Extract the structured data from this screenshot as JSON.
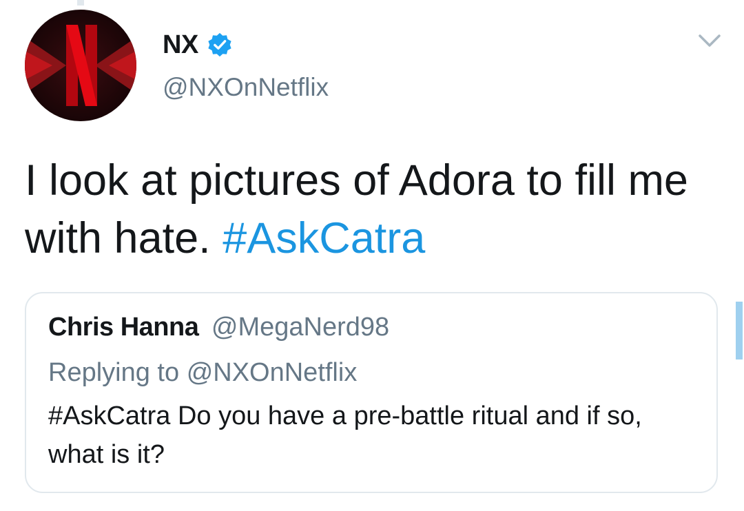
{
  "tweet": {
    "author": {
      "display_name": "NX",
      "handle": "@NXOnNetflix",
      "verified": true,
      "avatar_icon": "netflix-n-logo-icon"
    },
    "menu_icon": "chevron-down-icon",
    "text": "I look at pictures of Adora to fill me with hate.",
    "hashtag": "#AskCatra",
    "colors": {
      "hashtag": "#1b95e0",
      "secondary_text": "#657786",
      "verified_badge": "#1da1f2",
      "card_border": "#e1e8ed",
      "brand_red": "#e50914"
    }
  },
  "quoted_tweet": {
    "display_name": "Chris Hanna",
    "handle": "@MegaNerd98",
    "replying_to_label": "Replying to",
    "replying_to_handle": "@NXOnNetflix",
    "text": "#AskCatra Do you have a pre-battle ritual and if so, what is it?"
  }
}
